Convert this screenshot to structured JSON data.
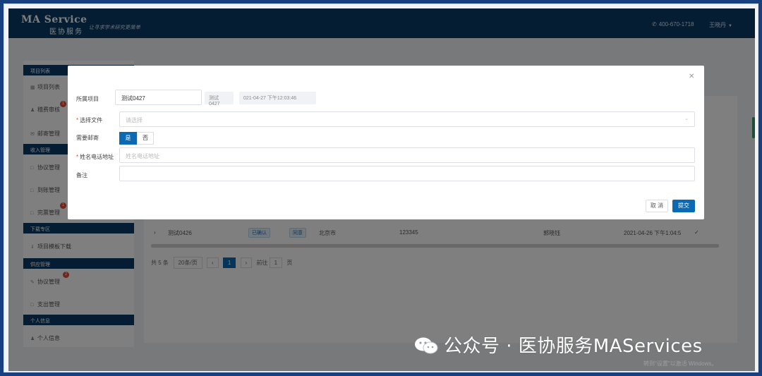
{
  "header": {
    "logo_main": "MA Service",
    "logo_sub": "医协服务",
    "logo_slogan": "让寻求学术研究更简单",
    "phone": "400-670-1718",
    "user": "王晓丹"
  },
  "sidebar": {
    "sections": [
      {
        "title": "项目列表",
        "items": [
          "项目列表",
          "稽费审核",
          "邮寄管理"
        ]
      },
      {
        "title": "收入管理",
        "items": [
          "协议管理",
          "到账管理",
          "完票管理"
        ]
      },
      {
        "title": "下载专区",
        "items": [
          "项目模板下载"
        ]
      },
      {
        "title": "供应管理",
        "items": [
          "协议管理",
          "支出管理"
        ]
      },
      {
        "title": "个人信息",
        "items": [
          "个人信息"
        ]
      }
    ],
    "badges": [
      "1",
      "1",
      "2"
    ]
  },
  "table": {
    "row": {
      "name": "测试0426",
      "status": "已确认",
      "tag": "同意",
      "city": "北京市",
      "code": "123345",
      "person": "郭晓钰",
      "time": "2021-04-26 下午1:04:5"
    }
  },
  "pagination": {
    "total": "共 5 条",
    "page_size": "20条/页",
    "current": "1",
    "goto_label": "前往",
    "goto_value": "1",
    "page_unit": "页"
  },
  "modal": {
    "project_label": "所属项目",
    "project_value": "测试0427",
    "project_code": "测试0427",
    "project_time": "021-04-27 下午12:03:46",
    "file_label": "选择文件",
    "file_placeholder": "请选择",
    "mail_label": "需要邮寄",
    "mail_yes": "是",
    "mail_no": "否",
    "address_label": "姓名电话地址",
    "address_placeholder": "姓名电话地址",
    "remark_label": "备注",
    "remark_value": "",
    "cancel": "取 消",
    "submit": "提交"
  },
  "watermark": {
    "text": "公众号 · 医协服务MAServices",
    "windows": "转到\"设置\"以激活 Windows。"
  },
  "colors": {
    "header": "#0a3b66",
    "primary": "#0a6ab3",
    "frame": "#18407f"
  }
}
